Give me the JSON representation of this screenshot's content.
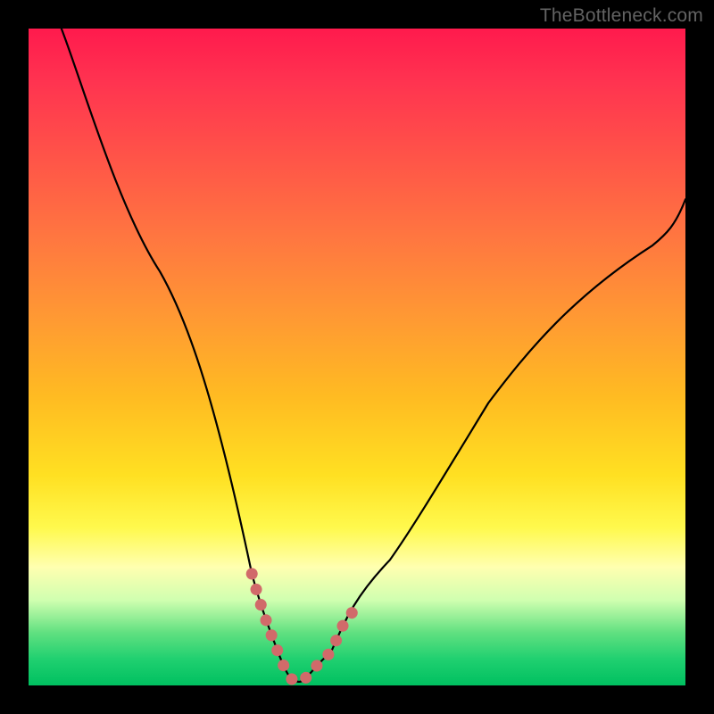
{
  "attribution": "TheBottleneck.com",
  "chart_data": {
    "type": "line",
    "title": "",
    "xlabel": "",
    "ylabel": "",
    "xlim": [
      0,
      100
    ],
    "ylim": [
      0,
      100
    ],
    "series": [
      {
        "name": "bottleneck-curve",
        "color": "#000000",
        "x": [
          5,
          10,
          15,
          20,
          25,
          30,
          34,
          36,
          38,
          40,
          42,
          44,
          46,
          48,
          50,
          55,
          60,
          65,
          70,
          75,
          80,
          85,
          90,
          95,
          100
        ],
        "y": [
          100,
          88,
          76,
          63,
          49,
          34,
          17,
          10,
          5,
          2,
          1,
          1,
          2,
          5,
          10,
          19,
          28,
          36,
          43,
          50,
          56,
          62,
          67,
          71,
          74
        ]
      },
      {
        "name": "sweet-spot-marker",
        "color": "#d16a6a",
        "x": [
          34,
          36,
          38,
          40,
          42,
          44,
          46,
          48,
          50
        ],
        "y": [
          17,
          10,
          5,
          2,
          1,
          1,
          2,
          5,
          10
        ]
      }
    ]
  }
}
